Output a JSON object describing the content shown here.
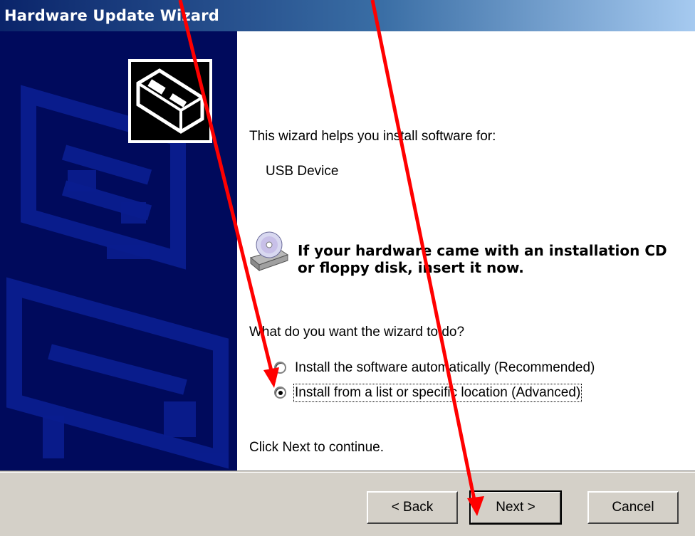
{
  "window": {
    "title": "Hardware Update Wizard"
  },
  "intro": {
    "line1": "This wizard helps you install software for:",
    "device": "USB Device"
  },
  "cd_notice": {
    "line1": "If your hardware came with an installation CD",
    "line2": "or floppy disk, insert it now."
  },
  "question": "What do you want the wizard to do?",
  "options": [
    {
      "label": "Install the software automatically (Recommended)",
      "selected": false
    },
    {
      "label": "Install from a list or specific location (Advanced)",
      "selected": true
    }
  ],
  "continue_hint": "Click Next to continue.",
  "buttons": {
    "back": "< Back",
    "next": "Next >",
    "cancel": "Cancel"
  },
  "colors": {
    "title_bar": "#0a246a",
    "side_panel": "#000a5c",
    "annotation_arrow": "#ff0000"
  },
  "icons": [
    "hardware-wizard-icon",
    "cd-drive-icon",
    "annotation-arrow"
  ]
}
